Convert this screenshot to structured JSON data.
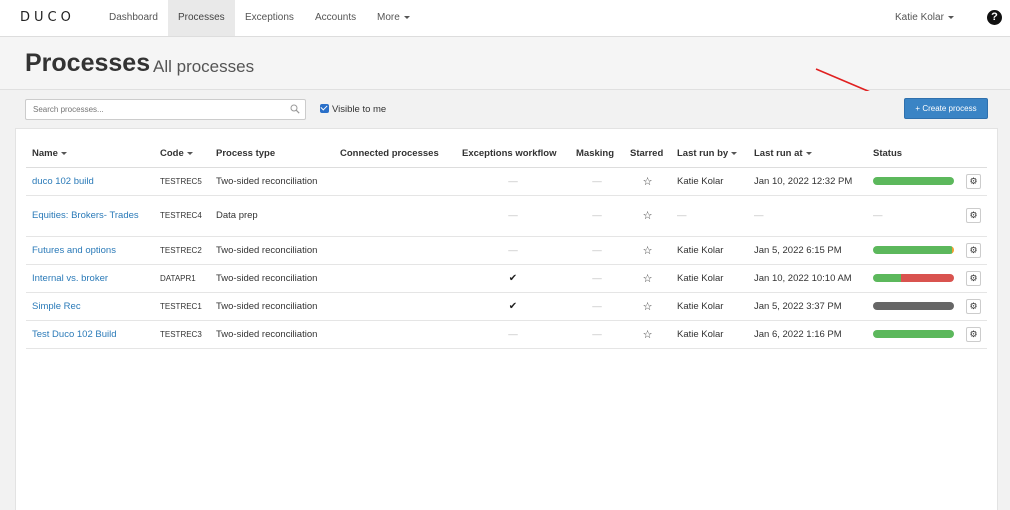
{
  "nav": {
    "logo": "DUCO",
    "items": [
      "Dashboard",
      "Processes",
      "Exceptions",
      "Accounts",
      "More"
    ],
    "user": "Katie Kolar",
    "help": "?"
  },
  "header": {
    "title": "Processes",
    "subtitle": "All processes"
  },
  "toolbar": {
    "search_placeholder": "Search processes...",
    "visible_label": "Visible to me",
    "create_label": "+ Create process"
  },
  "table": {
    "columns": [
      "Name",
      "Code",
      "Process type",
      "Connected processes",
      "Exceptions workflow",
      "Masking",
      "Starred",
      "Last run by",
      "Last run at",
      "Status"
    ],
    "rows": [
      {
        "name": "duco 102 build",
        "code": "TESTREC5",
        "type": "Two-sided reconciliation",
        "connected": "",
        "workflow": "—",
        "masking": "—",
        "starred": "☆",
        "run_by": "Katie Kolar",
        "run_at": "Jan 10, 2022 12:32 PM",
        "status": [
          1.0,
          0,
          0,
          0
        ]
      },
      {
        "name": "Equities: Brokers- Trades",
        "code": "TESTREC4",
        "type": "Data prep",
        "connected": "",
        "workflow": "—",
        "masking": "—",
        "starred": "☆",
        "run_by": "—",
        "run_at": "—",
        "status_text": "—"
      },
      {
        "name": "Futures and options",
        "code": "TESTREC2",
        "type": "Two-sided reconciliation",
        "connected": "",
        "workflow": "—",
        "masking": "—",
        "starred": "☆",
        "run_by": "Katie Kolar",
        "run_at": "Jan 5, 2022 6:15 PM",
        "status": [
          0.97,
          0.03,
          0,
          0
        ]
      },
      {
        "name": "Internal vs. broker",
        "code": "DATAPR1",
        "type": "Two-sided reconciliation",
        "connected": "",
        "workflow": "✔",
        "masking": "—",
        "starred": "☆",
        "run_by": "Katie Kolar",
        "run_at": "Jan 10, 2022 10:10 AM",
        "status": [
          0.35,
          0,
          0.65,
          0
        ]
      },
      {
        "name": "Simple Rec",
        "code": "TESTREC1",
        "type": "Two-sided reconciliation",
        "connected": "",
        "workflow": "✔",
        "masking": "—",
        "starred": "☆",
        "run_by": "Katie Kolar",
        "run_at": "Jan 5, 2022 3:37 PM",
        "status": [
          0,
          0,
          0,
          1.0
        ]
      },
      {
        "name": "Test Duco 102 Build",
        "code": "TESTREC3",
        "type": "Two-sided reconciliation",
        "connected": "",
        "workflow": "—",
        "masking": "—",
        "starred": "☆",
        "run_by": "Katie Kolar",
        "run_at": "Jan 6, 2022 1:16 PM",
        "status": [
          1.0,
          0,
          0,
          0
        ]
      }
    ]
  },
  "colors": {
    "status_green": "#5cb85c",
    "status_orange": "#f0a030",
    "status_red": "#d9534f",
    "status_grey": "#666666",
    "primary": "#3a84c5",
    "link": "#2a7ab8",
    "arrow": "#e02020"
  }
}
